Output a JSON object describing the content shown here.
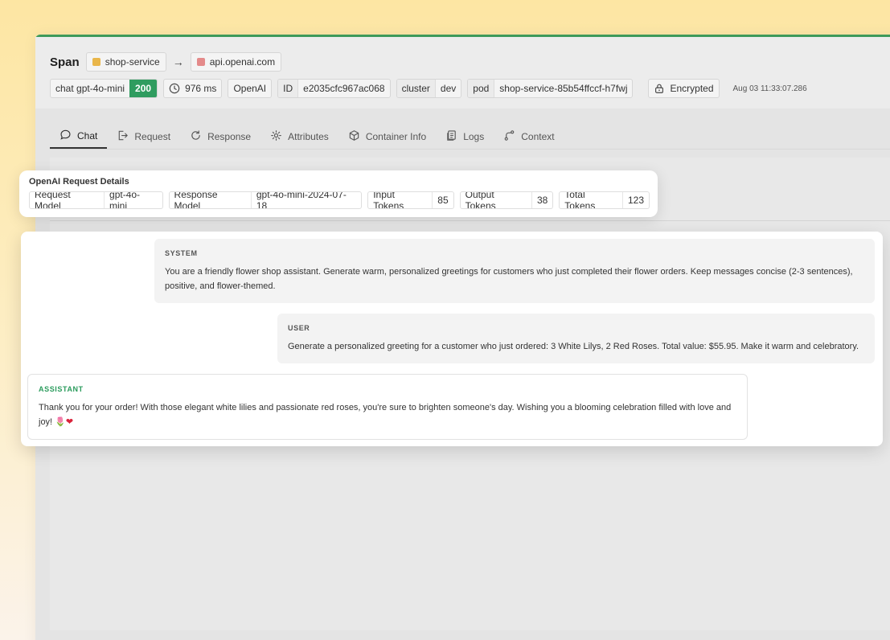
{
  "header": {
    "title": "Span",
    "source_service": "shop-service",
    "source_color": "#e9b64a",
    "arrow": "→",
    "target_service": "api.openai.com",
    "target_color": "#e48a8a"
  },
  "tags": {
    "operation": "chat gpt-4o-mini",
    "status_code": "200",
    "status_color": "#2f9c5f",
    "duration": "976 ms",
    "provider": "OpenAI",
    "id_label": "ID",
    "id_value": "e2035cfc967ac068",
    "cluster_label": "cluster",
    "cluster_value": "dev",
    "pod_label": "pod",
    "pod_value": "shop-service-85b54ffccf-h7fwj",
    "encrypted": "Encrypted",
    "timestamp": "Aug 03 11:33:07.286"
  },
  "tabs": [
    {
      "label": "Chat",
      "icon": "chat-bubble-icon",
      "active": true
    },
    {
      "label": "Request",
      "icon": "request-arrow-icon"
    },
    {
      "label": "Response",
      "icon": "refresh-icon"
    },
    {
      "label": "Attributes",
      "icon": "gear-icon"
    },
    {
      "label": "Container Info",
      "icon": "cube-icon"
    },
    {
      "label": "Logs",
      "icon": "logs-icon"
    },
    {
      "label": "Context",
      "icon": "context-icon"
    }
  ],
  "details": {
    "title": "OpenAI Request Details",
    "items": [
      {
        "key": "Request Model",
        "value": "gpt-4o-mini"
      },
      {
        "key": "Response Model",
        "value": "gpt-4o-mini-2024-07-18"
      },
      {
        "key": "Input Tokens",
        "value": "85"
      },
      {
        "key": "Output Tokens",
        "value": "38"
      },
      {
        "key": "Total Tokens",
        "value": "123"
      }
    ]
  },
  "chat": {
    "system": {
      "role": "SYSTEM",
      "text": "You are a friendly flower shop assistant. Generate warm, personalized greetings for customers who just completed their flower orders. Keep messages concise (2-3 sentences), positive, and flower-themed."
    },
    "user": {
      "role": "USER",
      "text": "Generate a personalized greeting for a customer who just ordered: 3 White Lilys, 2 Red Roses. Total value: $55.95. Make it warm and celebratory."
    },
    "assistant": {
      "role": "ASSISTANT",
      "text": "Thank you for your order! With those elegant white lilies and passionate red roses, you're sure to brighten someone's day. Wishing you a blooming celebration filled with love and joy!",
      "emoji_flower": "🌷",
      "emoji_heart": "❤"
    }
  }
}
